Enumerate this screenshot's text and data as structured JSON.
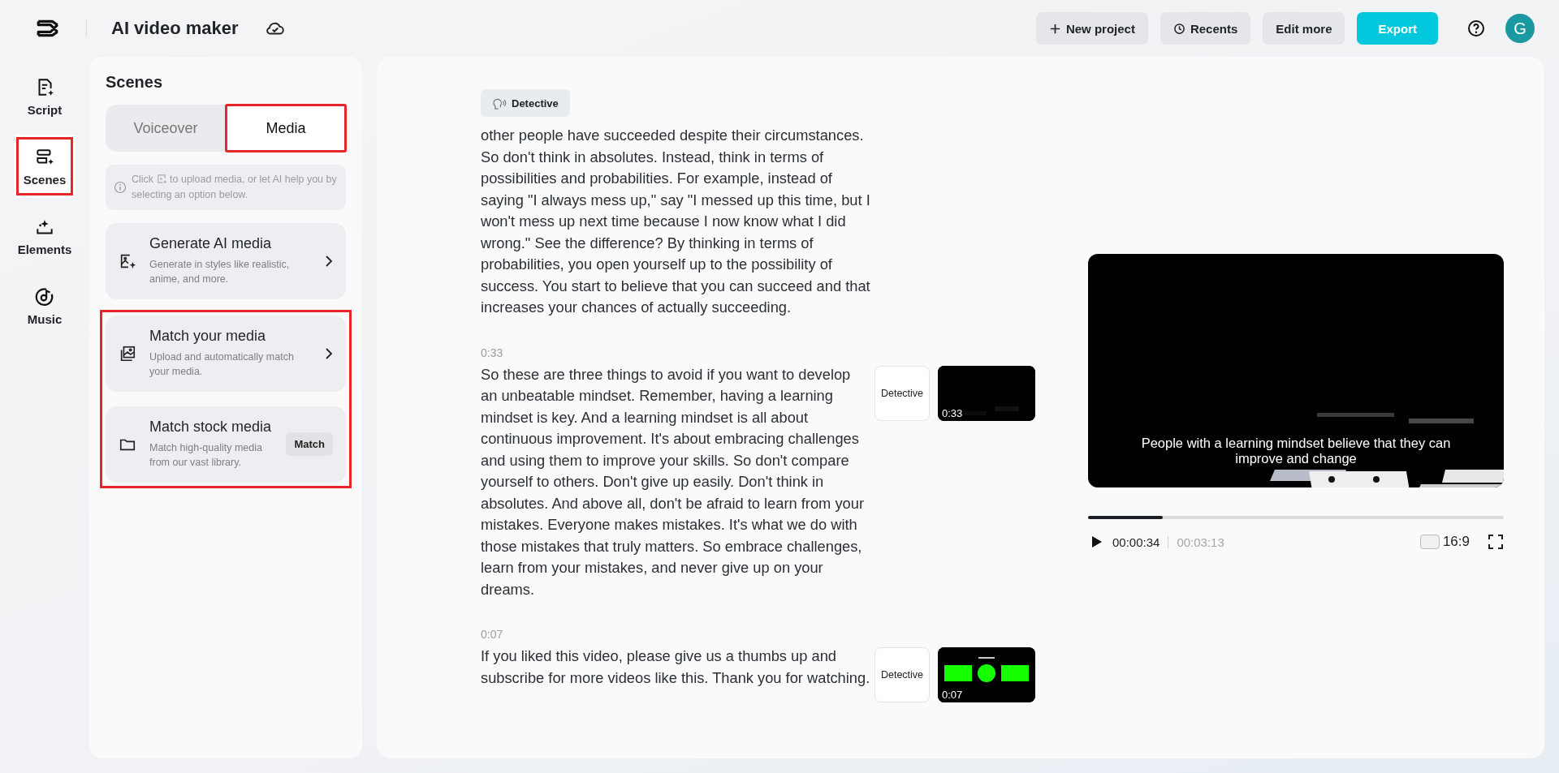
{
  "top_bar": {
    "title": "AI video maker",
    "buttons": [
      {
        "label": "New project",
        "kind": "plus"
      },
      {
        "label": "Recents",
        "kind": "clock"
      },
      {
        "label": "Edit more",
        "kind": "plain"
      },
      {
        "label": "Export",
        "kind": "primary"
      }
    ],
    "avatar": "G"
  },
  "rail": [
    {
      "label": "Script",
      "kind": "script",
      "selected": false,
      "highlighted": false
    },
    {
      "label": "Scenes",
      "kind": "scenes",
      "selected": true,
      "highlighted": true
    },
    {
      "label": "Elements",
      "kind": "elements",
      "selected": false,
      "highlighted": false
    },
    {
      "label": "Music",
      "kind": "music",
      "selected": false,
      "highlighted": false
    }
  ],
  "scenes_panel": {
    "title": "Scenes",
    "tabs": [
      {
        "label": "Voiceover",
        "selected": false,
        "highlighted": false
      },
      {
        "label": "Media",
        "selected": true,
        "highlighted": true
      }
    ],
    "info": {
      "before": "Click",
      "after": "to upload media, or let AI help you by selecting an option below."
    },
    "option_groups": [
      {
        "options": [
          {
            "title": "Generate AI media",
            "description": "Generate in styles like realistic, anime, and more.",
            "kind": "generate"
          }
        ]
      },
      {
        "highlighted": true,
        "options": [
          {
            "title": "Match your media",
            "description": "Upload and automatically match your media.",
            "kind": "match"
          },
          {
            "title": "Match stock media",
            "description": "Match high-quality media from our vast library.",
            "kind": "folder",
            "button": "Match"
          }
        ]
      }
    ]
  },
  "script": {
    "voice_chip": "Detective",
    "scenes": [
      {
        "paragraph": "other people have succeeded despite their circumstances. So don't think in absolutes. Instead, think in terms of possibilities and probabilities. For example, instead of saying \"I always mess up,\" say \"I messed up this time, but I won't mess up next time because I now know what I did wrong.\" See the difference? By thinking in terms of probabilities, you open yourself up to the possibility of success. You start to believe that you can succeed and that increases your chances of actually succeeding."
      },
      {
        "time": "0:33",
        "paragraph": "So these are three things to avoid if you want to develop an unbeatable mindset. Remember, having a learning mindset is key. And a learning mindset is all about continuous improvement. It's about embracing challenges and using them to improve your skills. So don't compare yourself to others. Don't give up easily. Don't think in absolutes. And above all, don't be afraid to learn from your mistakes. Everyone makes mistakes. It's what we do with those mistakes that truly matters. So embrace challenges, learn from your mistakes, and never give up on your dreams.",
        "voice": "Detective",
        "thumbnail": {
          "kind": "dark",
          "time": "0:33"
        }
      },
      {
        "time": "0:07",
        "paragraph": "If you liked this video, please give us a thumbs up and subscribe for more videos like this. Thank you for watching.",
        "voice": "Detective",
        "thumbnail": {
          "kind": "green",
          "time": "0:07"
        }
      }
    ]
  },
  "player": {
    "caption": "People with a learning mindset believe that they can improve and change",
    "level": 0.18,
    "current_time": "00:00:34",
    "total_time": "00:03:13",
    "aspect": "16:9"
  }
}
